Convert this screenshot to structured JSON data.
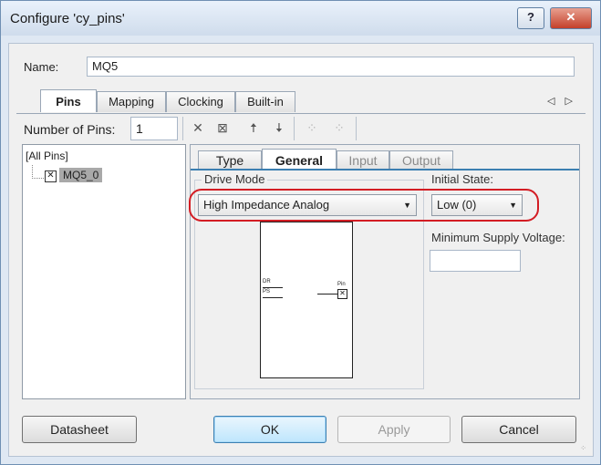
{
  "window": {
    "title": "Configure 'cy_pins'",
    "help_label": "?",
    "close_label": "✕"
  },
  "name_field": {
    "label": "Name:",
    "value": "MQ5"
  },
  "tabs": [
    {
      "label": "Pins"
    },
    {
      "label": "Mapping"
    },
    {
      "label": "Clocking"
    },
    {
      "label": "Built-in"
    }
  ],
  "tab_nav": "◁ ▷",
  "pins": {
    "number_label": "Number of Pins:",
    "number_value": "1",
    "toolbar": [
      "✕",
      "⊠",
      "🠅",
      "🠇",
      "⁘",
      "⁘"
    ],
    "tree_root": "[All Pins]",
    "tree_item": "MQ5_0"
  },
  "inner_tabs": [
    {
      "label": "Type"
    },
    {
      "label": "General"
    },
    {
      "label": "Input"
    },
    {
      "label": "Output"
    }
  ],
  "general": {
    "drive_mode_legend": "Drive Mode",
    "drive_mode_value": "High Impedance Analog",
    "initial_state_label": "Initial State:",
    "initial_state_value": "Low (0)",
    "min_supply_label": "Minimum Supply Voltage:",
    "min_supply_value": "",
    "diagram": {
      "dr": "DR",
      "ps": "PS",
      "pin": "Pin"
    }
  },
  "buttons": {
    "datasheet": "Datasheet",
    "ok": "OK",
    "apply": "Apply",
    "cancel": "Cancel"
  },
  "highlight_color": "#d31d24",
  "accent_color": "#3c7fb1"
}
